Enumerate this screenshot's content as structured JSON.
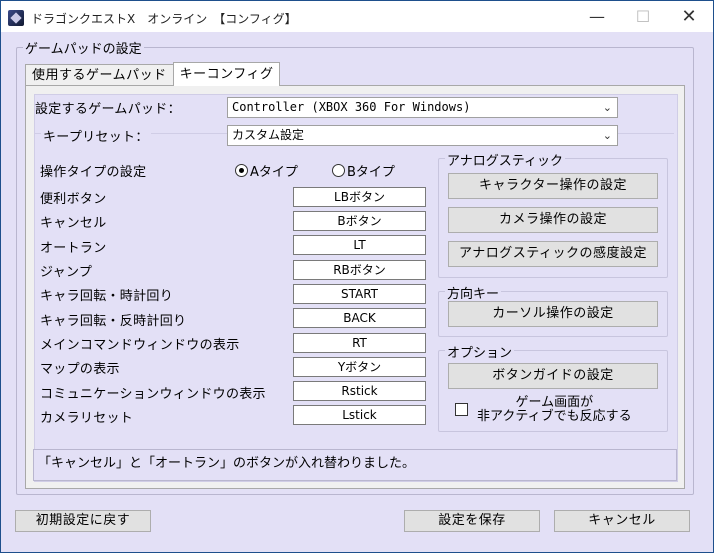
{
  "window": {
    "title": "ドラゴンクエストX　オンライン　【コンフィグ】",
    "minimize_label": "—",
    "maximize_label": "☐",
    "close_label": "✕"
  },
  "section_title": "ゲームパッドの設定",
  "tabs": [
    {
      "label": "使用するゲームパッド",
      "active": false
    },
    {
      "label": "キーコンフィグ",
      "active": true
    }
  ],
  "gamepad": {
    "label": "設定するゲームパッド：",
    "value": "Controller (XBOX 360 For Windows)"
  },
  "preset": {
    "label": "キープリセット：",
    "value": "カスタム設定"
  },
  "operation_type": {
    "label": "操作タイプの設定",
    "options": [
      {
        "label": "Aタイプ",
        "selected": true
      },
      {
        "label": "Bタイプ",
        "selected": false
      }
    ]
  },
  "key_bindings": [
    {
      "action": "便利ボタン",
      "key": "LBボタン"
    },
    {
      "action": "キャンセル",
      "key": "Bボタン"
    },
    {
      "action": "オートラン",
      "key": "LT"
    },
    {
      "action": "ジャンプ",
      "key": "RBボタン"
    },
    {
      "action": "キャラ回転・時計回り",
      "key": "START"
    },
    {
      "action": "キャラ回転・反時計回り",
      "key": "BACK"
    },
    {
      "action": "メインコマンドウィンドウの表示",
      "key": "RT"
    },
    {
      "action": "マップの表示",
      "key": "Yボタン"
    },
    {
      "action": "コミュニケーションウィンドウの表示",
      "key": "Rstick"
    },
    {
      "action": "カメラリセット",
      "key": "Lstick"
    }
  ],
  "analog": {
    "title": "アナログスティック",
    "buttons": [
      "キャラクター操作の設定",
      "カメラ操作の設定",
      "アナログスティックの感度設定"
    ]
  },
  "direction": {
    "title": "方向キー",
    "button": "カーソル操作の設定"
  },
  "options": {
    "title": "オプション",
    "button": "ボタンガイドの設定",
    "checkbox_label_1": "ゲーム画面が",
    "checkbox_label_2": "非アクティブでも反応する",
    "checkbox_checked": false
  },
  "status_message": "「キャンセル」と「オートラン」のボタンが入れ替わりました。",
  "footer": {
    "reset_label": "初期設定に戻す",
    "save_label": "設定を保存",
    "cancel_label": "キャンセル"
  }
}
